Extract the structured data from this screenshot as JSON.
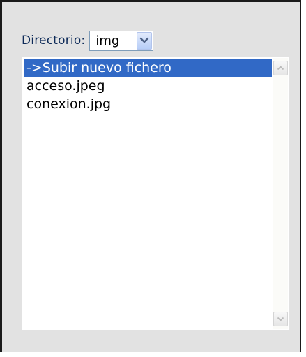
{
  "directory": {
    "label": "Directorio:",
    "selected": "img"
  },
  "files": [
    {
      "name": "->Subir nuevo fichero",
      "selected": true
    },
    {
      "name": "acceso.jpeg",
      "selected": false
    },
    {
      "name": "conexion.jpg",
      "selected": false
    }
  ],
  "icons": {
    "dropdown": "chevron-down-icon",
    "scroll_up": "scroll-up-arrow-icon",
    "scroll_down": "scroll-down-arrow-icon"
  },
  "colors": {
    "selection": "#3169c6",
    "label_text": "#0d2a58",
    "panel_bg": "#e2e2e2"
  }
}
